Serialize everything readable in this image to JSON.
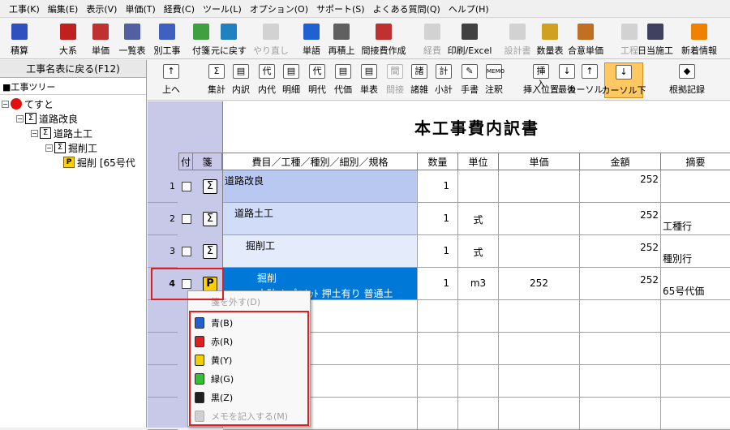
{
  "menubar": [
    "工事(K)",
    "編集(E)",
    "表示(V)",
    "単価(T)",
    "経費(C)",
    "ツール(L)",
    "オプション(O)",
    "サポート(S)",
    "よくある質問(Q)",
    "ヘルプ(H)"
  ],
  "toolbar1": [
    {
      "label": "積算",
      "icon": "globe-icon",
      "color": "#3050c0",
      "enabled": true
    },
    {
      "label": "大系",
      "icon": "flag-icon",
      "color": "#c02020",
      "enabled": true
    },
    {
      "label": "単価",
      "icon": "price-icon",
      "color": "#c03030",
      "enabled": true
    },
    {
      "label": "一覧表",
      "icon": "list-icon",
      "color": "#5060a0",
      "enabled": true
    },
    {
      "label": "別工事",
      "icon": "other-project-icon",
      "color": "#4060c0",
      "enabled": true
    },
    {
      "label": "付箋",
      "icon": "sticky-note-icon",
      "color": "#40a040",
      "enabled": true
    },
    {
      "label": "元に戻す",
      "icon": "undo-icon",
      "color": "#2080c0",
      "enabled": true
    },
    {
      "label": "やり直し",
      "icon": "redo-icon",
      "color": "#a0a0a0",
      "enabled": false
    },
    {
      "label": "単語",
      "icon": "word-icon",
      "color": "#2060d0",
      "enabled": true
    },
    {
      "label": "再積上",
      "icon": "recalc-icon",
      "color": "#606060",
      "enabled": true
    },
    {
      "label": "間接費作成",
      "icon": "indirect-cost-icon",
      "color": "#c03030",
      "enabled": true
    },
    {
      "label": "経費",
      "icon": "expense-icon",
      "color": "#a0a0a0",
      "enabled": false
    },
    {
      "label": "印刷/Excel",
      "icon": "printer-icon",
      "color": "#404040",
      "enabled": true
    },
    {
      "label": "設計書",
      "icon": "design-doc-icon",
      "color": "#a0a0a0",
      "enabled": false
    },
    {
      "label": "数量表",
      "icon": "quantity-table-icon",
      "color": "#d0a020",
      "enabled": true
    },
    {
      "label": "合意単価",
      "icon": "agreed-price-icon",
      "color": "#c07020",
      "enabled": true
    },
    {
      "label": "工程",
      "icon": "process-icon",
      "color": "#a0a0a0",
      "enabled": false
    },
    {
      "label": "日当施工",
      "icon": "daily-construction-icon",
      "color": "#404060",
      "enabled": true
    },
    {
      "label": "新着情報",
      "icon": "news-icon",
      "color": "#f08000",
      "enabled": true
    }
  ],
  "left": {
    "back_button": "工事名表に戻る(F12)",
    "tree_header": "■工事ツリー",
    "tree": [
      {
        "label": "てすと",
        "icon": "project-icon"
      },
      {
        "label": "道路改良",
        "icon": "sigma-icon"
      },
      {
        "label": "道路土工",
        "icon": "sigma-icon"
      },
      {
        "label": "掘削工",
        "icon": "sigma-icon"
      },
      {
        "label": "掘削 [65号代",
        "icon": "p-icon"
      }
    ]
  },
  "toolbar2": [
    {
      "label": "上へ",
      "glyph": "↑",
      "enabled": true
    },
    {
      "label": "集計",
      "glyph": "Σ",
      "enabled": true
    },
    {
      "label": "内訳",
      "glyph": "▤",
      "enabled": true
    },
    {
      "label": "内代",
      "glyph": "代",
      "enabled": true
    },
    {
      "label": "明細",
      "glyph": "▤",
      "enabled": true
    },
    {
      "label": "明代",
      "glyph": "代",
      "enabled": true
    },
    {
      "label": "代価",
      "glyph": "▤",
      "enabled": true
    },
    {
      "label": "単表",
      "glyph": "▤",
      "enabled": true
    },
    {
      "label": "間接",
      "glyph": "間",
      "enabled": false
    },
    {
      "label": "諸雑",
      "glyph": "諸",
      "enabled": true
    },
    {
      "label": "小計",
      "glyph": "計",
      "enabled": true
    },
    {
      "label": "手書",
      "glyph": "✎",
      "enabled": true
    },
    {
      "label": "注釈",
      "glyph": "MEMO",
      "enabled": true
    },
    {
      "label": "挿入位置",
      "glyph": "挿入",
      "enabled": true
    },
    {
      "label": "最後",
      "glyph": "↓",
      "enabled": true
    },
    {
      "label": "カーソル上",
      "glyph": "↑",
      "enabled": true
    },
    {
      "label": "カーソル下",
      "glyph": "↓",
      "enabled": true
    },
    {
      "label": "根拠記録",
      "glyph": "◆",
      "enabled": true
    }
  ],
  "sheet": {
    "title": "本工事費内訳書",
    "columns": [
      "付",
      "箋",
      "費目／工種／種別／細別／規格",
      "数量",
      "単位",
      "単価",
      "金額",
      "摘要"
    ],
    "rows": [
      {
        "num": "1",
        "name": "道路改良",
        "qty": "1",
        "unit": "",
        "price": "",
        "amount": "252",
        "memo": "",
        "type": "sigma"
      },
      {
        "num": "2",
        "name": "道路土工",
        "qty": "1",
        "unit": "式",
        "price": "",
        "amount": "252",
        "memo": "工種行",
        "type": "sigma"
      },
      {
        "num": "3",
        "name": "掘削工",
        "qty": "1",
        "unit": "式",
        "price": "",
        "amount": "252",
        "memo": "種別行",
        "type": "sigma"
      },
      {
        "num": "4",
        "name": "掘削",
        "name2": "土砂 ｵｰﾌﾟﾝｶｯﾄ 押土有り 普通土",
        "qty": "1",
        "unit": "m3",
        "price": "252",
        "amount": "252",
        "memo": "65号代価",
        "type": "p"
      }
    ]
  },
  "context_menu": {
    "items": [
      {
        "label": "箋を外す(D)",
        "color": "",
        "enabled": false
      },
      {
        "label": "青(B)",
        "color": "#2060d0",
        "enabled": true
      },
      {
        "label": "赤(R)",
        "color": "#e02020",
        "enabled": true
      },
      {
        "label": "黄(Y)",
        "color": "#f0d000",
        "enabled": true
      },
      {
        "label": "緑(G)",
        "color": "#30c030",
        "enabled": true
      },
      {
        "label": "黒(Z)",
        "color": "#202020",
        "enabled": true
      },
      {
        "label": "メモを記入する(M)",
        "color": "",
        "enabled": false
      }
    ]
  },
  "colors": {
    "highlight": "#e02020",
    "selected_row": "#0078d7",
    "level1": "#b8c8f0",
    "level2": "#d0dcf8",
    "level3": "#e4ecfc"
  }
}
